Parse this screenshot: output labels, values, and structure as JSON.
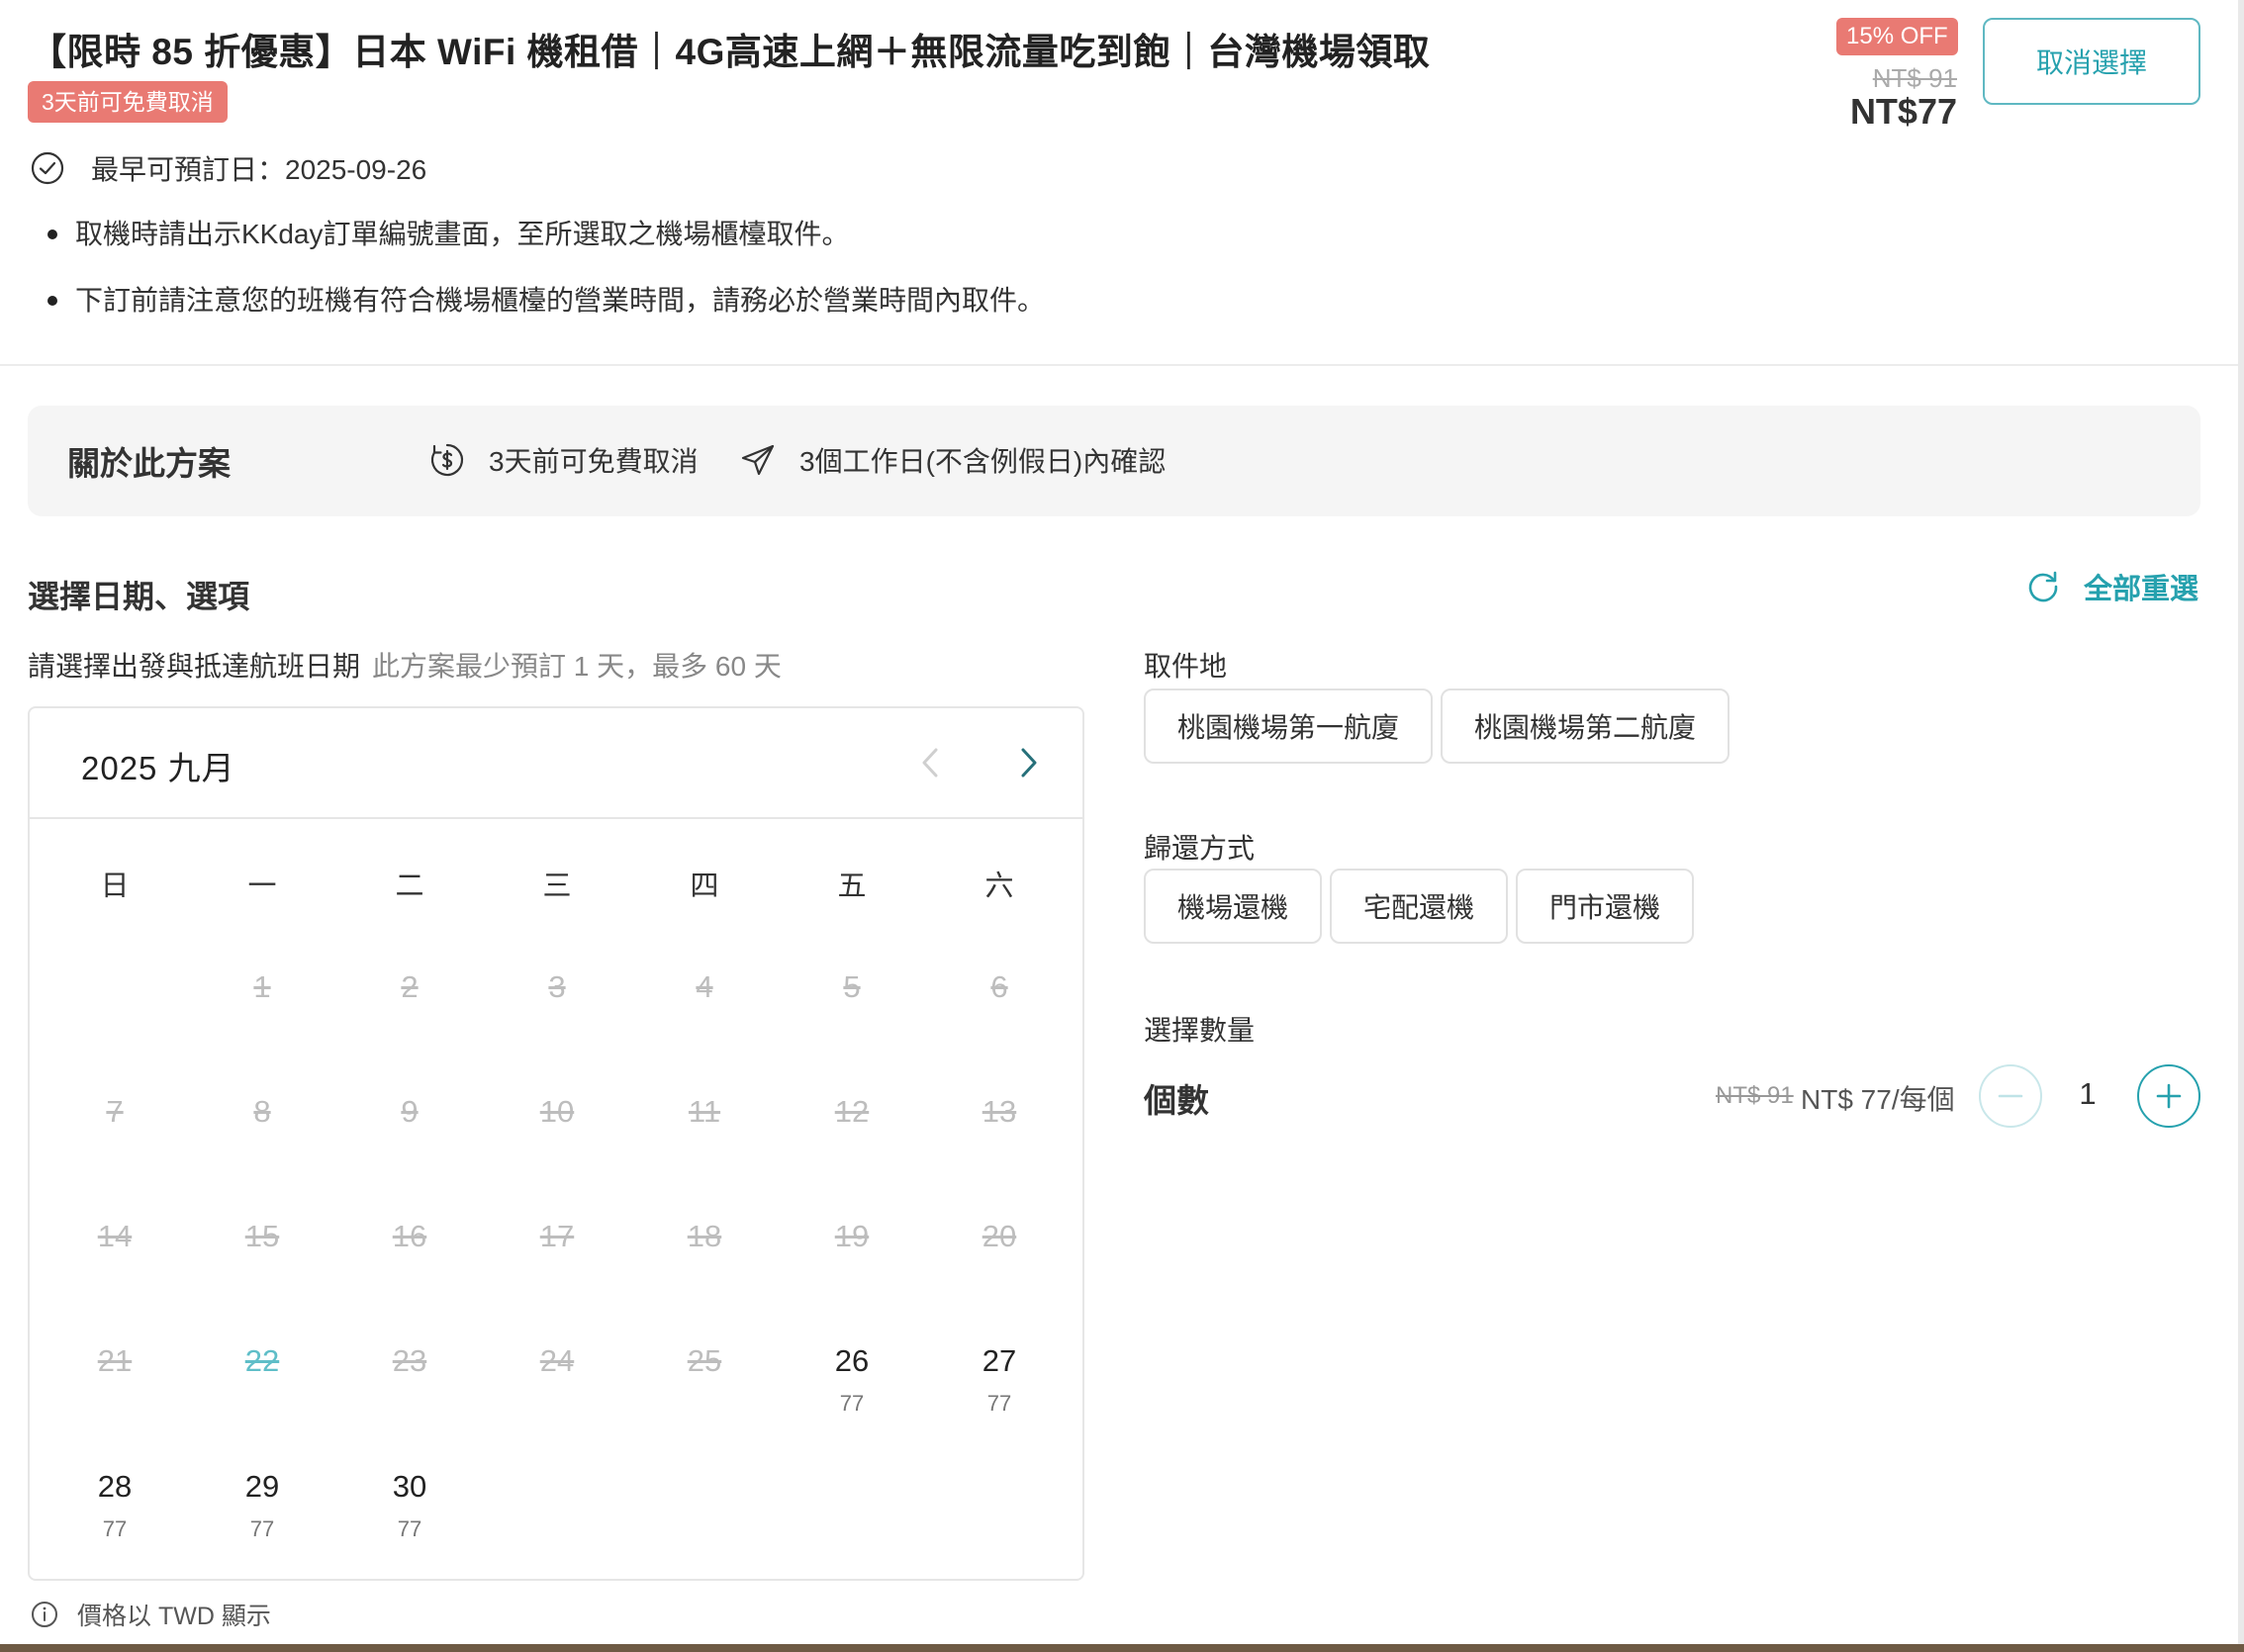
{
  "header": {
    "title": "【限時 85 折優惠】日本 WiFi 機租借｜4G高速上網＋無限流量吃到飽｜台灣機場領取",
    "cancel_badge": "3天前可免費取消",
    "earliest_date": "最早可預訂日：2025-09-26",
    "notes": [
      "取機時請出示KKday訂單編號畫面，至所選取之機場櫃檯取件。",
      "下訂前請注意您的班機有符合機場櫃檯的營業時間，請務必於營業時間內取件。"
    ],
    "discount_badge": "15% OFF",
    "old_price": "NT$ 91",
    "new_price": "NT$77",
    "cancel_selection_label": "取消選擇"
  },
  "about": {
    "title": "關於此方案",
    "free_cancel": "3天前可免費取消",
    "confirm": "3個工作日(不含例假日)內確認"
  },
  "section": {
    "title": "選擇日期、選項",
    "reset_label": "全部重選",
    "date_hint": "請選擇出發與抵達航班日期",
    "date_hint_sub": "此方案最少預訂 1 天，最多 60 天"
  },
  "calendar": {
    "month_label": "2025 九月",
    "weekdays": [
      "日",
      "一",
      "二",
      "三",
      "四",
      "五",
      "六"
    ],
    "days": [
      {
        "d": "1",
        "p": "",
        "s": "disabled"
      },
      {
        "d": "2",
        "p": "",
        "s": "disabled"
      },
      {
        "d": "3",
        "p": "",
        "s": "disabled"
      },
      {
        "d": "4",
        "p": "",
        "s": "disabled"
      },
      {
        "d": "5",
        "p": "",
        "s": "disabled"
      },
      {
        "d": "6",
        "p": "",
        "s": "disabled"
      },
      {
        "d": "7",
        "p": "",
        "s": "disabled"
      },
      {
        "d": "8",
        "p": "",
        "s": "disabled"
      },
      {
        "d": "9",
        "p": "",
        "s": "disabled"
      },
      {
        "d": "10",
        "p": "",
        "s": "disabled"
      },
      {
        "d": "11",
        "p": "",
        "s": "disabled"
      },
      {
        "d": "12",
        "p": "",
        "s": "disabled"
      },
      {
        "d": "13",
        "p": "",
        "s": "disabled"
      },
      {
        "d": "14",
        "p": "",
        "s": "disabled"
      },
      {
        "d": "15",
        "p": "",
        "s": "disabled"
      },
      {
        "d": "16",
        "p": "",
        "s": "disabled"
      },
      {
        "d": "17",
        "p": "",
        "s": "disabled"
      },
      {
        "d": "18",
        "p": "",
        "s": "disabled"
      },
      {
        "d": "19",
        "p": "",
        "s": "disabled"
      },
      {
        "d": "20",
        "p": "",
        "s": "disabled"
      },
      {
        "d": "21",
        "p": "",
        "s": "disabled"
      },
      {
        "d": "22",
        "p": "",
        "s": "today"
      },
      {
        "d": "23",
        "p": "",
        "s": "disabled"
      },
      {
        "d": "24",
        "p": "",
        "s": "disabled"
      },
      {
        "d": "25",
        "p": "",
        "s": "disabled"
      },
      {
        "d": "26",
        "p": "77",
        "s": "avail"
      },
      {
        "d": "27",
        "p": "77",
        "s": "avail"
      },
      {
        "d": "28",
        "p": "77",
        "s": "avail"
      },
      {
        "d": "29",
        "p": "77",
        "s": "avail"
      },
      {
        "d": "30",
        "p": "77",
        "s": "avail"
      }
    ],
    "currency_note": "價格以 TWD 顯示"
  },
  "pickup": {
    "label": "取件地",
    "options": [
      "桃園機場第一航廈",
      "桃園機場第二航廈"
    ]
  },
  "return": {
    "label": "歸還方式",
    "options": [
      "機場還機",
      "宅配還機",
      "門市還機"
    ]
  },
  "quantity": {
    "section_label": "選擇數量",
    "item_label": "個數",
    "old_unit_price": "NT$ 91",
    "unit_price": "NT$ 77/每個",
    "value": "1"
  },
  "colors": {
    "accent": "#26a1ae",
    "badge": "#e97a73"
  }
}
